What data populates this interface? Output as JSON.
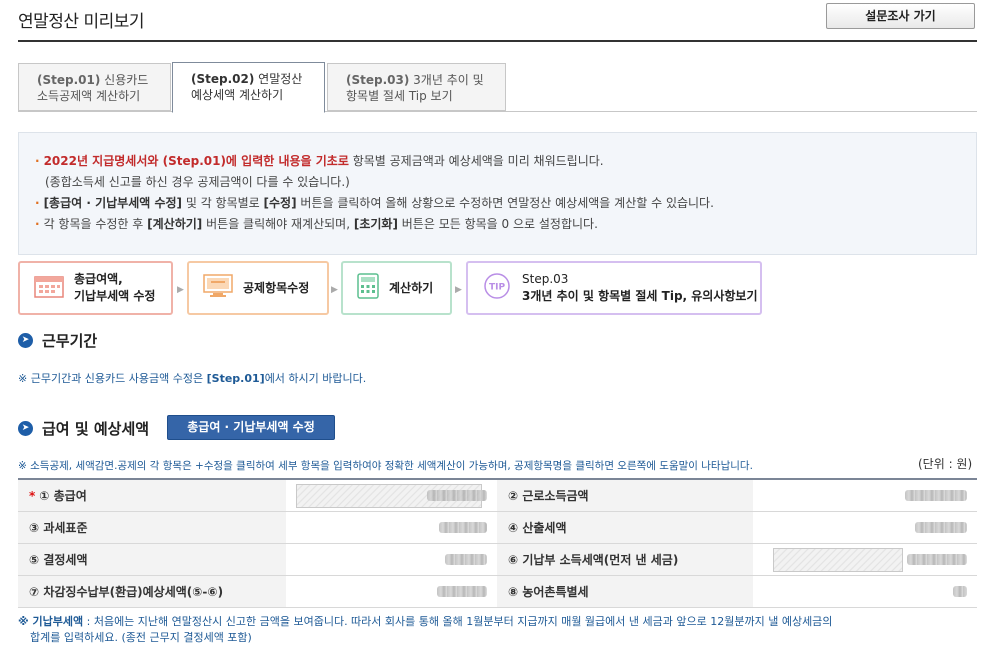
{
  "header": {
    "title": "연말정산 미리보기",
    "survey_button": "설문조사 가기"
  },
  "tabs": [
    {
      "step": "(Step.01)",
      "label_1": "신용카드",
      "label_2": "소득공제액 계산하기",
      "active": false
    },
    {
      "step": "(Step.02)",
      "label_1": "연말정산",
      "label_2": "예상세액 계산하기",
      "active": true
    },
    {
      "step": "(Step.03)",
      "label_1": "3개년 추이 및",
      "label_2": "항목별 절세 Tip 보기",
      "active": false
    }
  ],
  "info": {
    "line1_red": "2022년 지급명세서와 (Step.01)에 입력한 내용을 기초로",
    "line1_rest": " 항목별 공제금액과 예상세액을 미리 채워드립니다.",
    "line1_sub": "(종합소득세 신고를 하신 경우 공제금액이 다를 수 있습니다.)",
    "line2_b1": "[총급여 · 기납부세액 수정]",
    "line2_m1": " 및 각 항목별로 ",
    "line2_b2": "[수정]",
    "line2_rest": " 버튼을 클릭하여 올해 상황으로 수정하면 연말정산 예상세액을 계산할 수 있습니다.",
    "line3_start": "각 항목을 수정한 후 ",
    "line3_b1": "[계산하기]",
    "line3_m1": " 버튼을 클릭해야 재계산되며, ",
    "line3_b2": "[초기화]",
    "line3_rest": " 버튼은 모든 항목을 0 으로 설정합니다."
  },
  "flow": [
    {
      "label_1": "총급여액,",
      "label_2": "기납부세액 수정",
      "icon": "calendar-icon",
      "color": "#f0b2a8"
    },
    {
      "label_1": "공제항목수정",
      "label_2": "",
      "icon": "monitor-icon",
      "color": "#f6c9a3"
    },
    {
      "label_1": "계산하기",
      "label_2": "",
      "icon": "calculator-icon",
      "color": "#b8e2cc"
    },
    {
      "label_1": "Step.03",
      "label_2": "3개년 추이 및 항목별 절세 Tip, 유의사항보기",
      "icon": "tip-icon",
      "icon_text": "TIP",
      "color": "#d5bff0"
    }
  ],
  "section1": {
    "title": "근무기간",
    "note_pre": "※ 근무기간과 신용카드 사용금액 수정은 ",
    "note_bold": "[Step.01]",
    "note_post": "에서 하시기 바랍니다."
  },
  "section2": {
    "title": "급여 및 예상세액",
    "edit_button": "총급여 · 기납부세액 수정",
    "note": "※ 소득공제, 세액감면.공제의 각 항목은 +수정을 클릭하여 세부 항목을 입력하여야 정확한 세액계산이 가능하며, 공제항목명을 클릭하면 오른쪽에 도움말이 나타납니다.",
    "unit": "(단위 : 원)"
  },
  "table": {
    "rows": [
      {
        "l_label": "① 총급여",
        "l_required": "*",
        "r_label": "② 근로소득금액"
      },
      {
        "l_label": "③ 과세표준",
        "r_label": "④ 산출세액"
      },
      {
        "l_label": "⑤ 결정세액",
        "r_label": "⑥ 기납부 소득세액(먼저 낸 세금)"
      },
      {
        "l_label": "⑦ 차감징수납부(환급)예상세액(⑤-⑥)",
        "r_label": "⑧ 농어촌특별세"
      }
    ]
  },
  "footer": {
    "bold": "※ 기납부세액",
    "line1": " : 처음에는 지난해 연말정산시 신고한 금액을 보여줍니다. 따라서 회사를 통해 올해 1월분부터 지급까지 매월 월급에서 낸 세금과 앞으로 12월분까지 낼 예상세금의",
    "line2": "합계를 입력하세요. (종전 근무지 결정세액 포함)"
  }
}
